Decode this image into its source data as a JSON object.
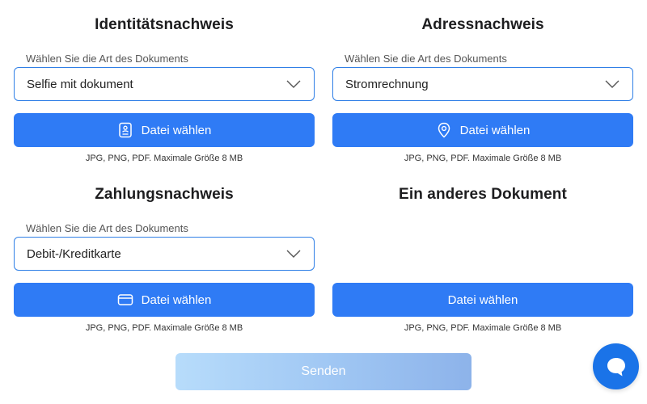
{
  "colors": {
    "accent": "#2f7bf5",
    "border": "#2f7fe6",
    "send_disabled_start": "#b7dcfb",
    "send_disabled_end": "#8db3ea",
    "chat": "#1a73e8"
  },
  "sections": [
    {
      "title": "Identitätsnachweis",
      "select_label": "Wählen Sie die Art des Dokuments",
      "select_value": "Selfie mit dokument",
      "button_label": "Datei wählen",
      "button_icon": "id-card-icon",
      "hint": "JPG, PNG, PDF. Maximale Größe 8 MB"
    },
    {
      "title": "Adressnachweis",
      "select_label": "Wählen Sie die Art des Dokuments",
      "select_value": "Stromrechnung",
      "button_label": "Datei wählen",
      "button_icon": "location-pin-icon",
      "hint": "JPG, PNG, PDF. Maximale Größe 8 MB"
    },
    {
      "title": "Zahlungsnachweis",
      "select_label": "Wählen Sie die Art des Dokuments",
      "select_value": "Debit-/Kreditkarte",
      "button_label": "Datei wählen",
      "button_icon": "credit-card-icon",
      "hint": "JPG, PNG, PDF. Maximale Größe 8 MB"
    },
    {
      "title": "Ein anderes Dokument",
      "button_label": "Datei wählen",
      "hint": "JPG, PNG, PDF. Maximale Größe 8 MB"
    }
  ],
  "send_label": "Senden",
  "chat_icon": "chat-bubble-icon"
}
